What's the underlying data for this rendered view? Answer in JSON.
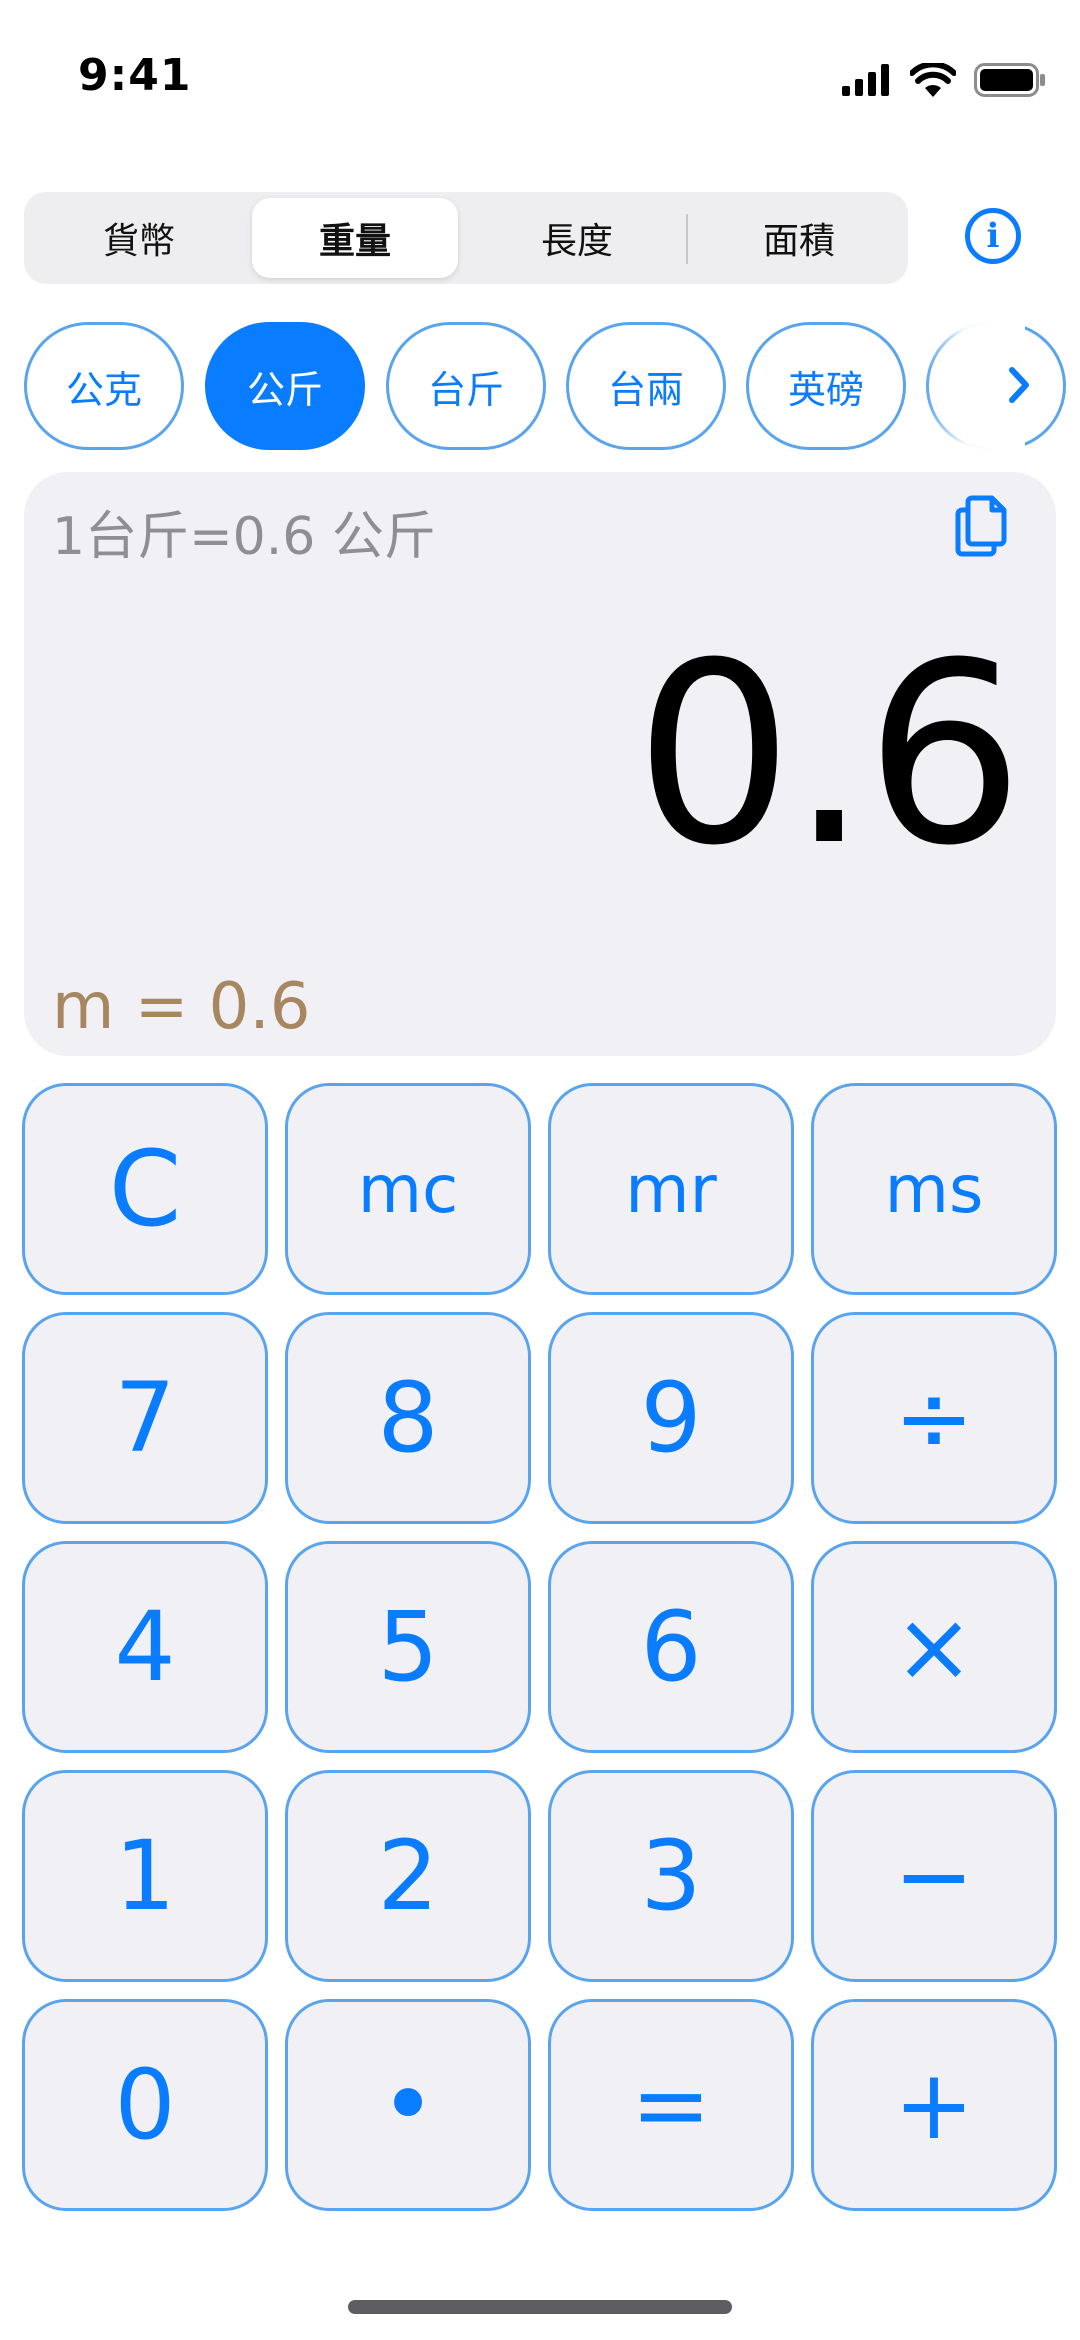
{
  "status_bar": {
    "time": "9:41"
  },
  "tabs": [
    {
      "label": "貨幣",
      "active": false
    },
    {
      "label": "重量",
      "active": true
    },
    {
      "label": "長度",
      "active": false
    },
    {
      "label": "面積",
      "active": false
    }
  ],
  "info_label": "i",
  "units": [
    {
      "label": "公克",
      "active": false
    },
    {
      "label": "公斤",
      "active": true
    },
    {
      "label": "台斤",
      "active": false
    },
    {
      "label": "台兩",
      "active": false
    },
    {
      "label": "英磅",
      "active": false
    }
  ],
  "display": {
    "conversion": "1台斤=0.6 公斤",
    "result": "0.6",
    "memory": "m = 0.6"
  },
  "keys": {
    "clear": "C",
    "mc": "mc",
    "mr": "mr",
    "ms": "ms",
    "seven": "7",
    "eight": "8",
    "nine": "9",
    "divide": "÷",
    "four": "4",
    "five": "5",
    "six": "6",
    "multiply": "×",
    "one": "1",
    "two": "2",
    "three": "3",
    "minus": "−",
    "zero": "0",
    "dot": "•",
    "equals": "=",
    "plus": "+"
  },
  "colors": {
    "accent": "#0a7cff",
    "key_background": "#f0f0f5",
    "key_border": "#5aa4ee",
    "memory_text": "#a68760",
    "conversion_text": "#8e8e93"
  }
}
